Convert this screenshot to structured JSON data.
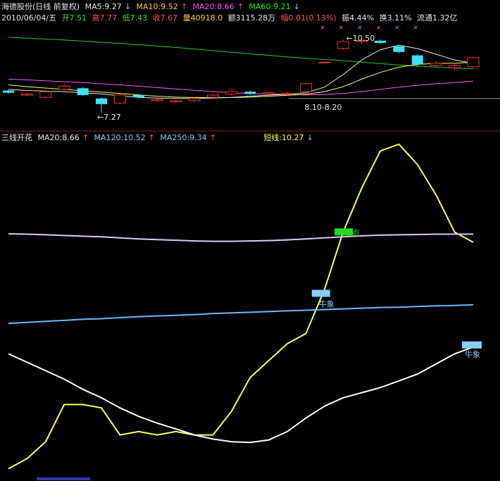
{
  "header": {
    "stock": "海德股份(日线 前复权)",
    "ma5": "MA5:9.27",
    "ma5_arrow": "↓",
    "ma10": "MA10:9.52",
    "ma10_arrow": "↑",
    "ma20": "MA20:8.66",
    "ma20_arrow": "↑",
    "ma60": "MA60:9.21",
    "ma60_arrow": "↓"
  },
  "quote": {
    "date": "2010/06/04/五",
    "open_label": "开",
    "open": "7.51",
    "high_label": "高",
    "high": "7.77",
    "low_label": "低",
    "low": "7.43",
    "close_label": "收",
    "close": "7.67",
    "vol_label": "量",
    "vol": "40918.0",
    "amt_label": "额",
    "amt": "3115.28万",
    "chg_label": "幅",
    "chg": "0.01(0.13%)",
    "amp_label": "振",
    "amp": "4.44%",
    "turn_label": "换",
    "turn": "3.11%",
    "float_label": "流通",
    "float": "1.32亿"
  },
  "indicator": {
    "name": "三线开花",
    "ma20": "MA20:8.66",
    "ma20_arrow": "↑",
    "ma120": "MA120:10.52",
    "ma120_arrow": "↑",
    "ma250": "MA250:9.34",
    "ma250_arrow": "↑",
    "short": "短线:10.27",
    "short_arrow": "↓"
  },
  "colors": {
    "up": "#ff3030",
    "down": "#40e0ff",
    "ma5": "#e8e8e8",
    "ma10": "#ffff55",
    "ma20": "#ff55ff",
    "ma60": "#22cc22",
    "short": "#ffff55",
    "sell": "#22dd22",
    "bull": "#88ccff"
  },
  "chart_data": [
    {
      "type": "candlestick",
      "y_range": [
        6.9,
        11.0
      ],
      "annotations": {
        "low_label": "←7.27",
        "low_value": 7.27,
        "high_label": "←10.50",
        "high_value": 10.5,
        "range_label": "8.10-8.20"
      },
      "candles": [
        {
          "o": 8.25,
          "c": 8.15,
          "h": 8.3,
          "l": 8.1
        },
        {
          "o": 8.05,
          "c": 8.1,
          "h": 8.15,
          "l": 8.0
        },
        {
          "o": 7.95,
          "c": 8.2,
          "h": 8.3,
          "l": 7.9
        },
        {
          "o": 8.3,
          "c": 8.45,
          "h": 8.55,
          "l": 8.25
        },
        {
          "o": 8.35,
          "c": 8.05,
          "h": 8.4,
          "l": 8.0
        },
        {
          "o": 7.9,
          "c": 7.65,
          "h": 7.95,
          "l": 7.27
        },
        {
          "o": 7.7,
          "c": 8.05,
          "h": 8.1,
          "l": 7.65
        },
        {
          "o": 8.05,
          "c": 7.95,
          "h": 8.1,
          "l": 7.9
        },
        {
          "o": 7.8,
          "c": 7.85,
          "h": 7.95,
          "l": 7.75
        },
        {
          "o": 7.75,
          "c": 7.8,
          "h": 7.85,
          "l": 7.7
        },
        {
          "o": 7.8,
          "c": 7.9,
          "h": 7.95,
          "l": 7.75
        },
        {
          "o": 7.95,
          "c": 8.05,
          "h": 8.1,
          "l": 7.9
        },
        {
          "o": 8.1,
          "c": 8.2,
          "h": 8.25,
          "l": 8.05
        },
        {
          "o": 8.2,
          "c": 8.1,
          "h": 8.25,
          "l": 8.05
        },
        {
          "o": 8.1,
          "c": 8.15,
          "h": 8.2,
          "l": 8.1
        },
        {
          "o": 8.1,
          "c": 8.12,
          "h": 8.2,
          "l": 8.05
        },
        {
          "o": 8.2,
          "c": 8.55,
          "h": 8.6,
          "l": 8.15
        },
        {
          "o": 9.5,
          "c": 9.5,
          "h": 9.5,
          "l": 9.5
        },
        {
          "o": 10.1,
          "c": 10.4,
          "h": 10.5,
          "l": 10.05
        },
        {
          "o": 10.45,
          "c": 10.45,
          "h": 10.6,
          "l": 10.3
        },
        {
          "o": 10.45,
          "c": 10.35,
          "h": 10.5,
          "l": 10.3
        },
        {
          "o": 10.2,
          "c": 9.95,
          "h": 10.25,
          "l": 9.9
        },
        {
          "o": 9.8,
          "c": 9.4,
          "h": 9.85,
          "l": 9.3
        },
        {
          "o": 9.35,
          "c": 9.45,
          "h": 9.55,
          "l": 9.3
        },
        {
          "o": 9.25,
          "c": 9.35,
          "h": 9.45,
          "l": 9.15
        },
        {
          "o": 9.3,
          "c": 9.7,
          "h": 9.75,
          "l": 9.25
        }
      ],
      "series": [
        {
          "name": "MA5",
          "color": "#e8e8e8",
          "values": [
            8.3,
            8.25,
            8.22,
            8.2,
            8.15,
            8.1,
            8.02,
            7.95,
            7.92,
            7.9,
            7.9,
            7.92,
            7.95,
            8.0,
            8.05,
            8.08,
            8.15,
            8.4,
            8.95,
            9.6,
            10.05,
            10.25,
            10.1,
            9.85,
            9.6,
            9.45
          ]
        },
        {
          "name": "MA10",
          "color": "#ffff55",
          "values": [
            8.5,
            8.42,
            8.36,
            8.3,
            8.24,
            8.18,
            8.12,
            8.06,
            8.0,
            7.96,
            7.94,
            7.93,
            7.94,
            7.96,
            8.0,
            8.04,
            8.08,
            8.2,
            8.42,
            8.75,
            9.05,
            9.28,
            9.4,
            9.45,
            9.45,
            9.5
          ]
        },
        {
          "name": "MA20",
          "color": "#ff55ff",
          "values": [
            8.75,
            8.72,
            8.68,
            8.64,
            8.6,
            8.55,
            8.5,
            8.44,
            8.38,
            8.32,
            8.26,
            8.2,
            8.15,
            8.12,
            8.1,
            8.08,
            8.06,
            8.07,
            8.12,
            8.2,
            8.3,
            8.4,
            8.48,
            8.55,
            8.6,
            8.66
          ]
        },
        {
          "name": "MA60",
          "color": "#22cc22",
          "values": [
            10.6,
            10.56,
            10.52,
            10.48,
            10.43,
            10.38,
            10.33,
            10.27,
            10.21,
            10.15,
            10.08,
            10.01,
            9.94,
            9.87,
            9.8,
            9.73,
            9.67,
            9.62,
            9.57,
            9.5,
            9.44,
            9.38,
            9.33,
            9.28,
            9.24,
            9.21
          ]
        }
      ]
    },
    {
      "type": "line",
      "y_range": [
        0,
        100
      ],
      "labels": {
        "sell": "卖点",
        "bull1": "牛象",
        "bull2": "牛象"
      },
      "series": [
        {
          "name": "短线",
          "color": "#ffff55",
          "values": [
            3,
            6,
            11,
            22,
            22,
            21,
            13,
            14,
            13,
            14,
            13,
            13,
            20,
            30,
            35,
            40,
            43,
            56,
            73,
            86,
            97,
            99,
            93,
            84,
            73,
            70
          ]
        },
        {
          "name": "",
          "color": "#dcc8ff",
          "values": [
            72.5,
            72.4,
            72.2,
            72.0,
            71.8,
            71.6,
            71.3,
            71.0,
            70.8,
            70.6,
            70.4,
            70.3,
            70.3,
            70.4,
            70.5,
            70.7,
            71.0,
            71.3,
            71.6,
            71.9,
            72.1,
            72.2,
            72.3,
            72.4,
            72.4,
            72.4
          ]
        },
        {
          "name": "",
          "color": "#66bbff",
          "values": [
            46,
            46.3,
            46.6,
            46.9,
            47.2,
            47.4,
            47.7,
            48.0,
            48.2,
            48.4,
            48.6,
            48.9,
            49.1,
            49.3,
            49.5,
            49.7,
            49.9,
            50.1,
            50.3,
            50.5,
            50.7,
            50.8,
            51.0,
            51.2,
            51.3,
            51.5
          ]
        },
        {
          "name": "",
          "color": "#ffffff",
          "values": [
            37,
            34.5,
            32,
            29.5,
            26.5,
            24,
            21,
            18.5,
            16.5,
            14.8,
            13,
            11.8,
            11,
            10.8,
            11.5,
            14,
            18,
            21.5,
            24,
            25.5,
            27,
            29,
            31,
            34,
            37,
            39
          ]
        }
      ]
    }
  ]
}
